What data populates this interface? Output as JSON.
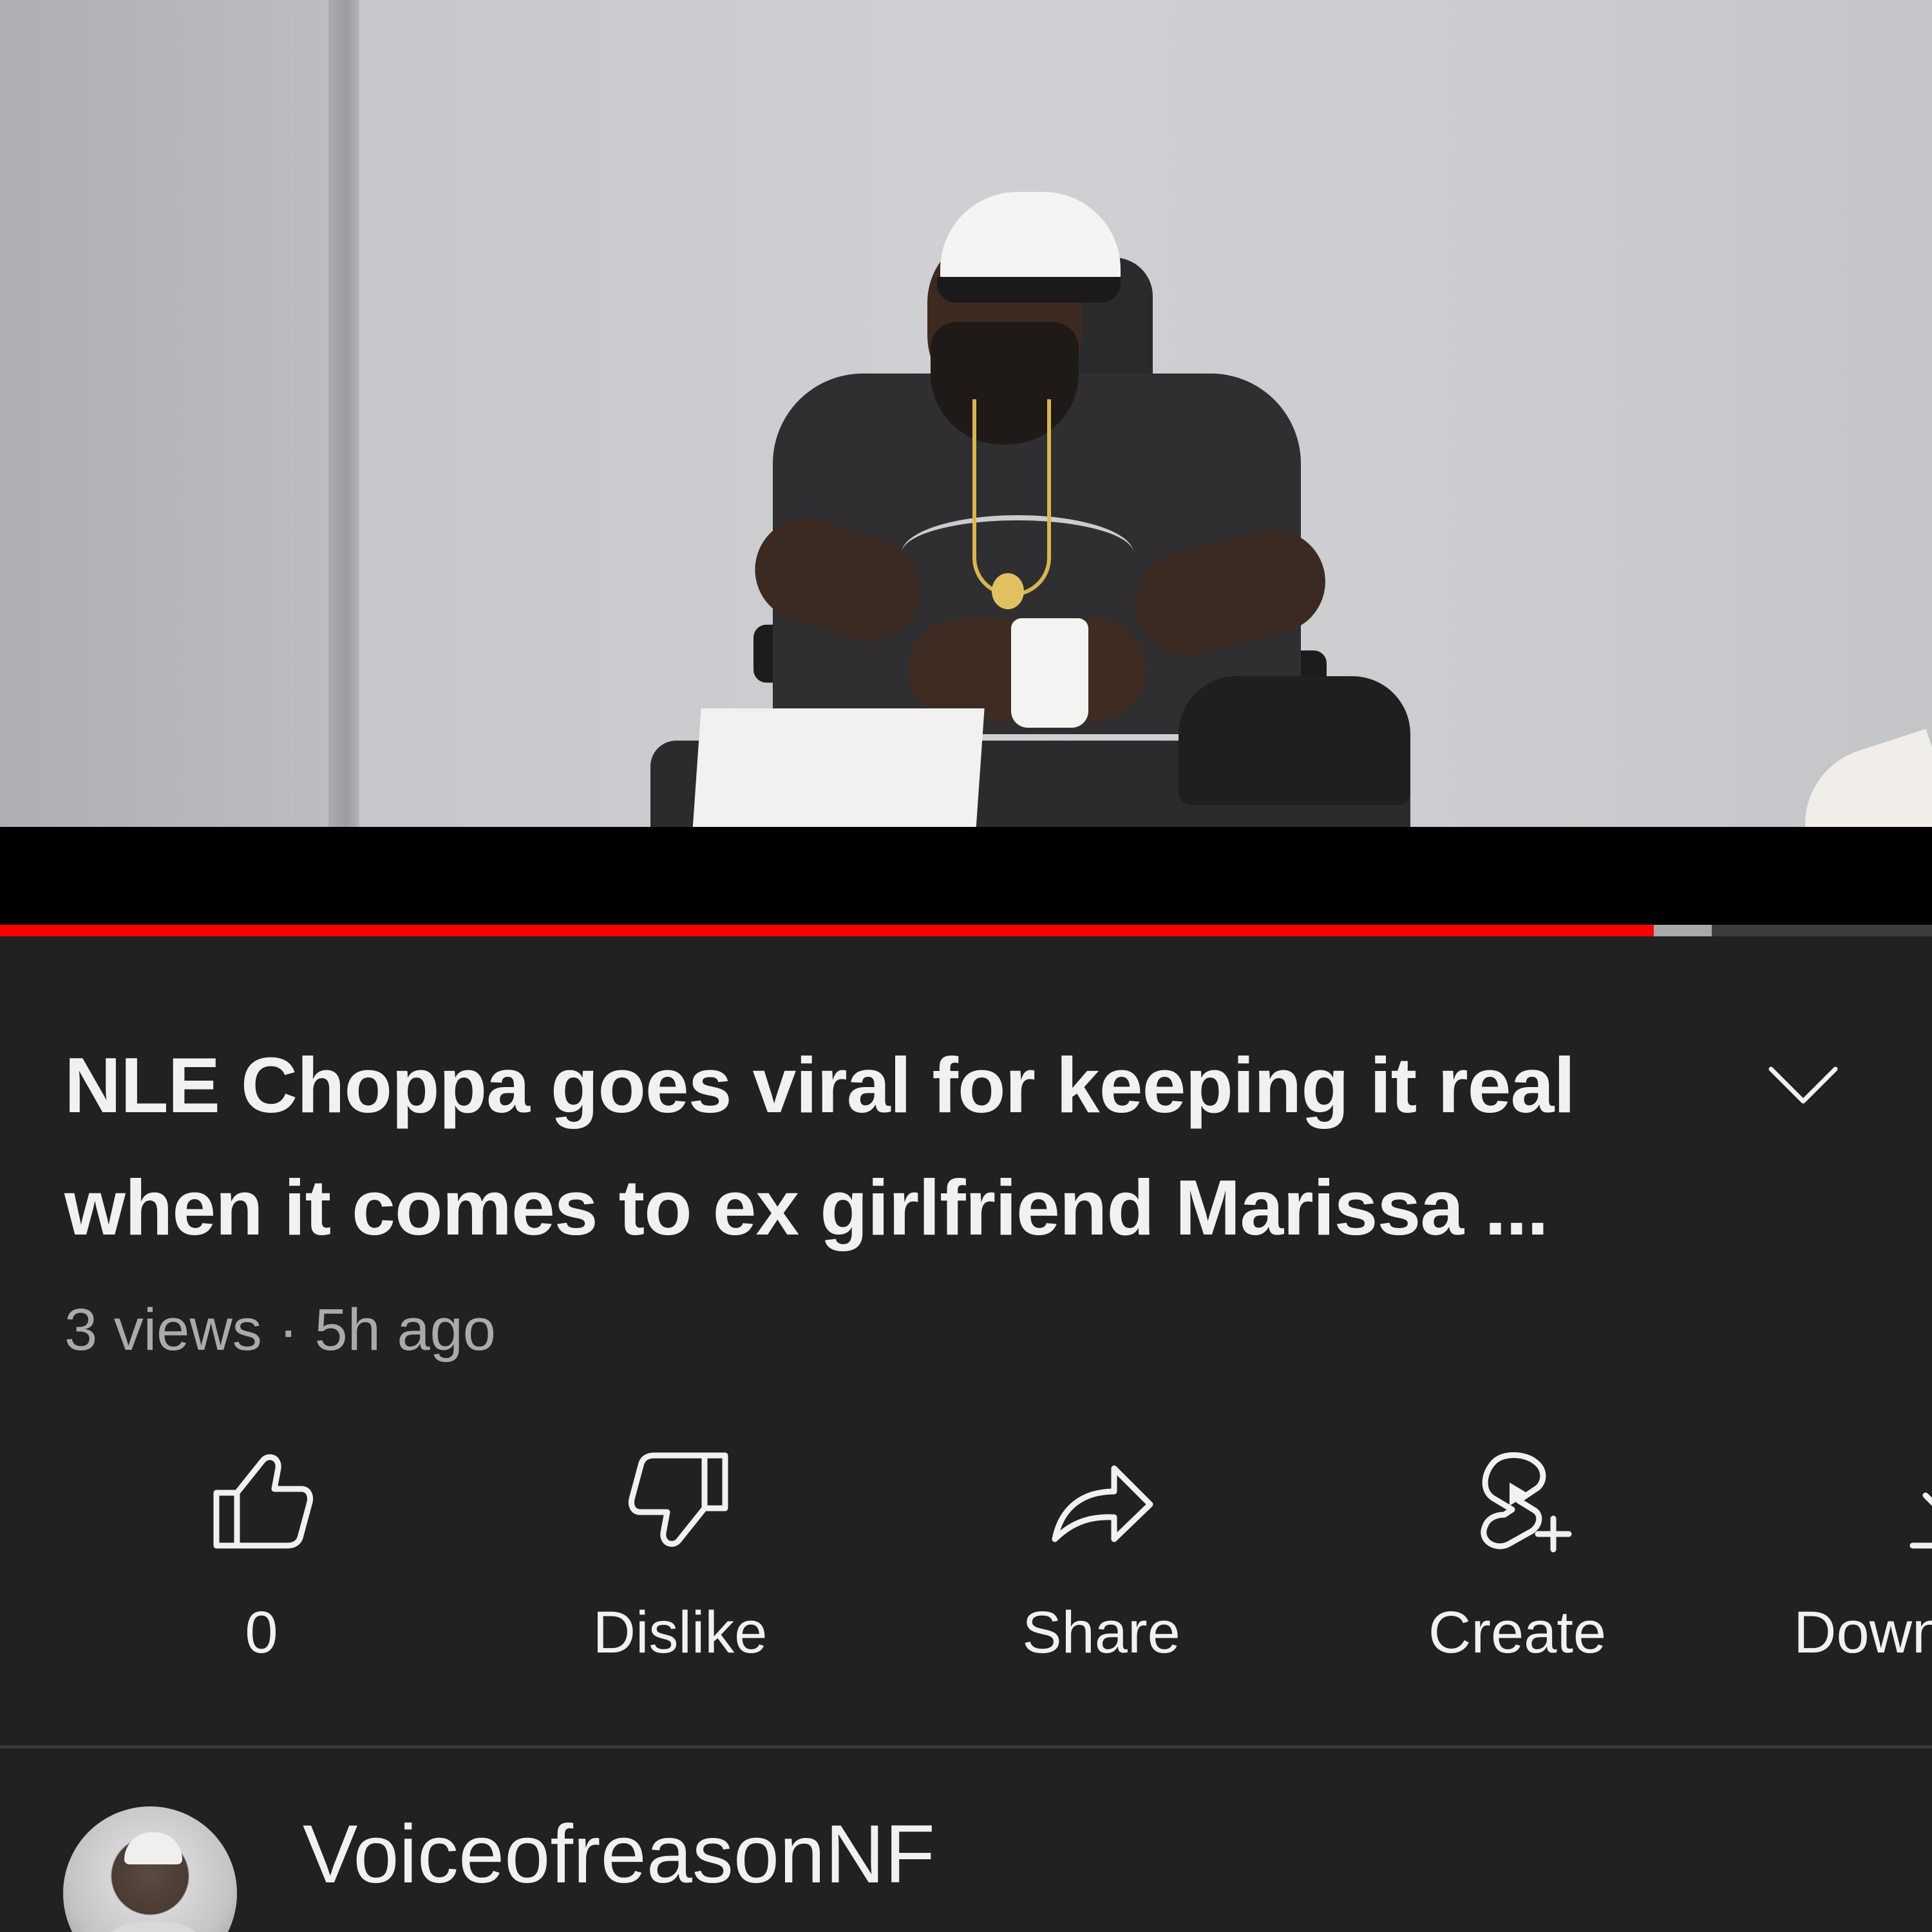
{
  "video": {
    "progress_played": 0.856,
    "progress_buffered": 0.886
  },
  "title": "NLE Choppa goes viral for keeping it real when it comes to ex girlfriend Marissa ...",
  "meta": {
    "views": "3 views",
    "separator": "·",
    "age": "5h ago"
  },
  "actions": [
    {
      "name": "like",
      "icon": "thumbs-up-icon",
      "label": "0"
    },
    {
      "name": "dislike",
      "icon": "thumbs-down-icon",
      "label": "Dislike"
    },
    {
      "name": "share",
      "icon": "share-arrow-icon",
      "label": "Share"
    },
    {
      "name": "create",
      "icon": "create-remix-icon",
      "label": "Create"
    },
    {
      "name": "download",
      "icon": "download-icon",
      "label": "Download"
    }
  ],
  "channel": {
    "name": "VoiceofreasonNF"
  },
  "colors": {
    "background": "#212121",
    "progress_played": "#ff0000",
    "text_primary": "#f1f1f1",
    "text_secondary": "#aaaaaa"
  }
}
